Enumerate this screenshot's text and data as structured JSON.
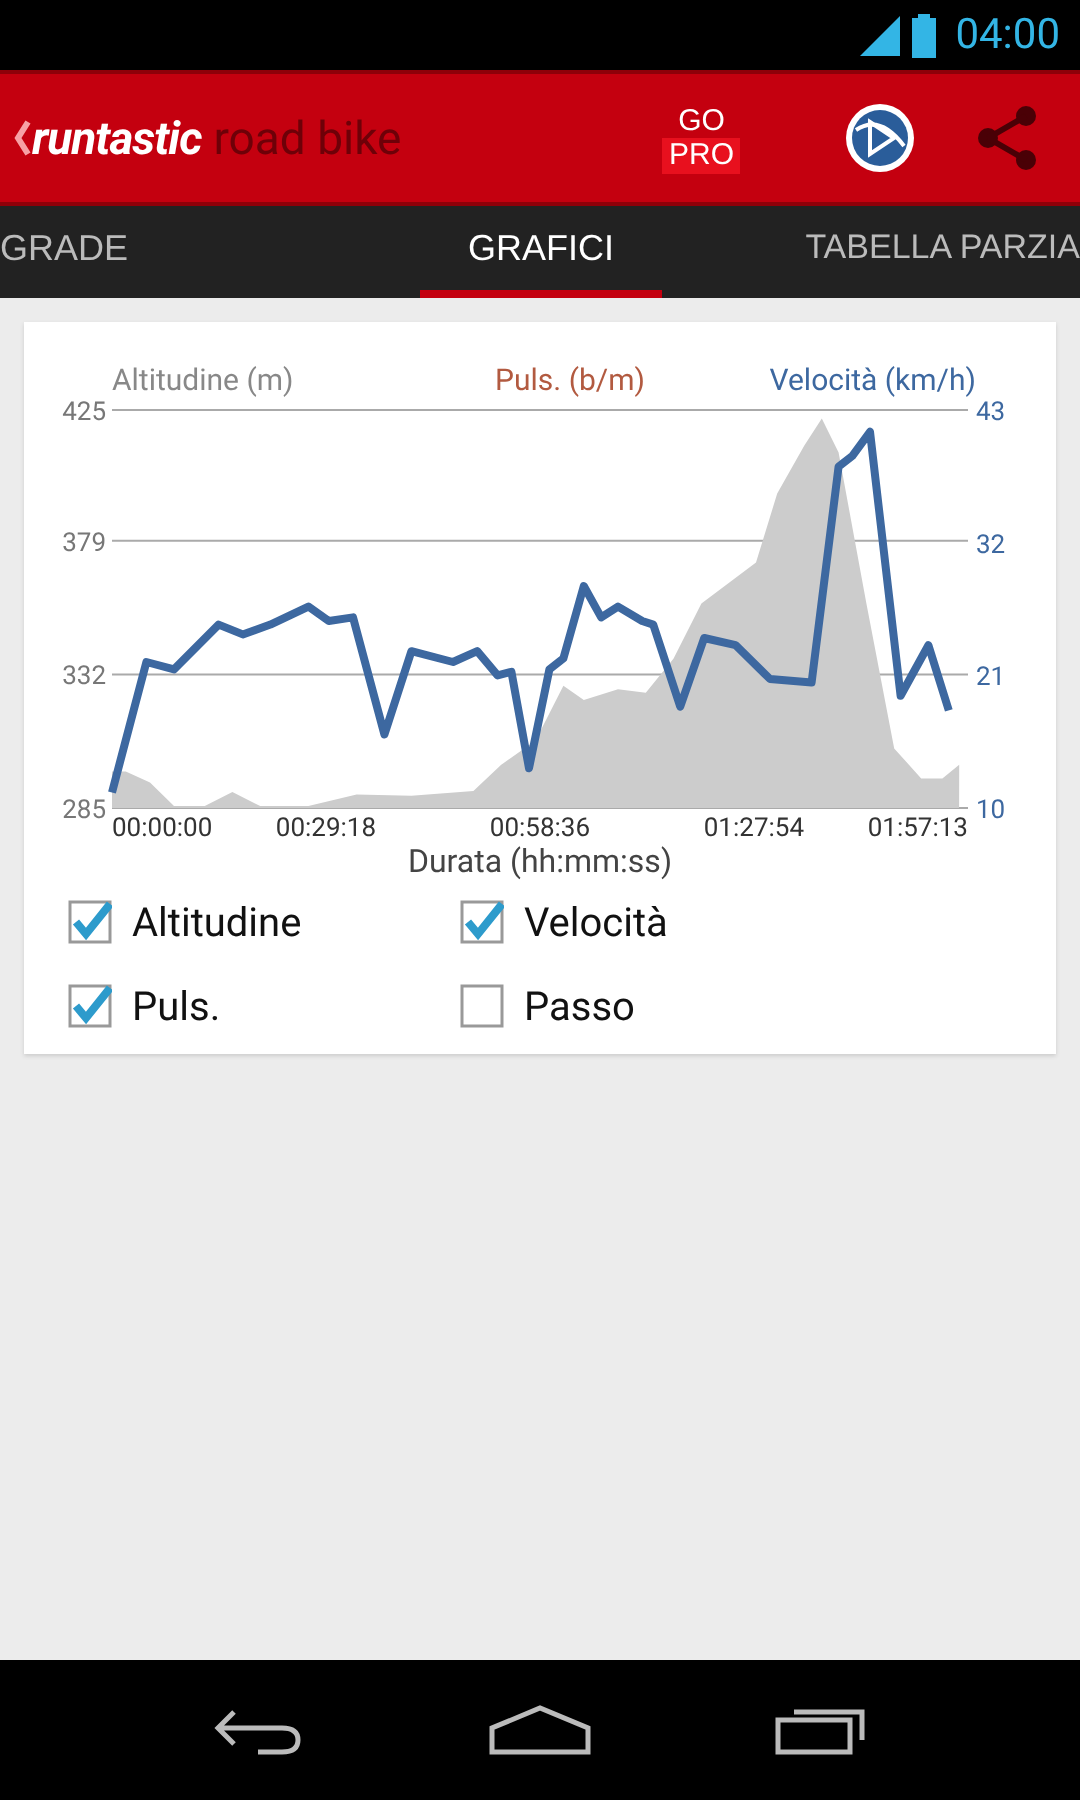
{
  "status_bar": {
    "time": "04:00"
  },
  "action_bar": {
    "logo_brand": "runtastic",
    "logo_product": "road bike",
    "go_pro": {
      "line1": "GO",
      "line2": "PRO"
    }
  },
  "tabs": [
    {
      "label": "GRADE",
      "selected": false
    },
    {
      "label": "GRAFICI",
      "selected": true
    },
    {
      "label": "TABELLA PARZIA",
      "selected": false
    }
  ],
  "chart": {
    "chart_data": {
      "type": "line",
      "xlabel": "Durata (hh:mm:ss)",
      "ylabel": "Altitudine (m)",
      "y2label": "Velocità (km/h)",
      "title": "Puls. (b/m)",
      "xlim": [
        0,
        117.2167
      ],
      "ylim": [
        285,
        425
      ],
      "y2lim": [
        10,
        43
      ],
      "xticks": [
        {
          "value": 0,
          "label": "00:00:00"
        },
        {
          "value": 29.3,
          "label": "00:29:18"
        },
        {
          "value": 58.6,
          "label": "00:58:36"
        },
        {
          "value": 87.9,
          "label": "01:27:54"
        },
        {
          "value": 117.2167,
          "label": "01:57:13"
        }
      ],
      "yticks": [
        {
          "value": 285,
          "label": "285"
        },
        {
          "value": 332,
          "label": "332"
        },
        {
          "value": 379,
          "label": "379"
        },
        {
          "value": 425,
          "label": "425"
        }
      ],
      "y2ticks": [
        {
          "value": 10,
          "label": "10"
        },
        {
          "value": 21,
          "label": "21"
        },
        {
          "value": 32,
          "label": "32"
        },
        {
          "value": 43,
          "label": "43"
        }
      ],
      "series": [
        {
          "type": "area",
          "color": "#cccccc",
          "x": [
            0,
            1.9,
            5.2,
            8.5,
            12.7,
            16.5,
            20.3,
            26.9,
            33.5,
            41,
            49.5,
            53.3,
            58,
            61.8,
            64.6,
            69.3,
            73.1,
            76.9,
            80.7,
            88.2,
            91.1,
            94.8,
            97.2,
            99.5,
            103.3,
            107.1,
            110.8,
            113.7,
            116
          ],
          "values": [
            297.8,
            297.8,
            294,
            285.7,
            285.7,
            290.6,
            285.7,
            285.7,
            289.8,
            289.3,
            291,
            300.2,
            308.7,
            328,
            323,
            326.8,
            325.5,
            337.6,
            357,
            371.4,
            395.6,
            412.4,
            422,
            410,
            357,
            306,
            295.4,
            295.4,
            300.2
          ]
        },
        {
          "type": "line",
          "axis": "y2",
          "color": "#3d68a0",
          "x": [
            0,
            4.7,
            8.5,
            14.6,
            17.9,
            21.7,
            26.9,
            29.7,
            33,
            37.3,
            41,
            46.7,
            50,
            52.8,
            54.7,
            57.1,
            59.9,
            61.8,
            64.6,
            67,
            69.3,
            72.6,
            74.1,
            77.8,
            81.1,
            85.4,
            90.1,
            95.8,
            99.5,
            101.4,
            103.8,
            108,
            111.8,
            114.6
          ],
          "values": [
            11.3,
            22.1,
            21.5,
            25.2,
            24.4,
            25.2,
            26.7,
            25.5,
            25.8,
            16.1,
            23,
            22.1,
            23,
            21,
            21.3,
            13.3,
            21.5,
            22.4,
            28.4,
            25.8,
            26.7,
            25.5,
            25.2,
            18.4,
            24.1,
            23.5,
            20.7,
            20.4,
            38.3,
            39.2,
            41.2,
            19.3,
            23.5,
            18.1
          ]
        }
      ]
    }
  },
  "options": [
    {
      "label": "Altitudine",
      "checked": true
    },
    {
      "label": "Velocità",
      "checked": true
    },
    {
      "label": "Puls.",
      "checked": true
    },
    {
      "label": "Passo",
      "checked": false
    }
  ]
}
